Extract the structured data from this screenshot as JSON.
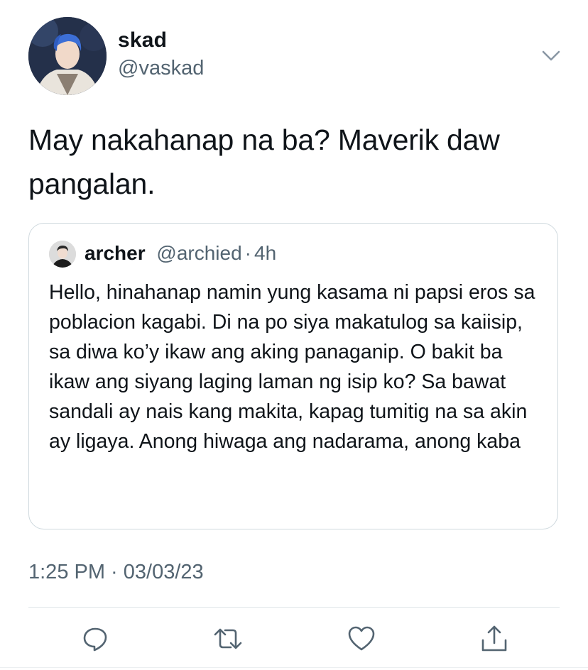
{
  "author": {
    "display_name": "skad",
    "handle": "@vaskad"
  },
  "tweet": {
    "text": "May nakahanap na ba? Maverik daw pangalan.",
    "timestamp": "1:25 PM · 03/03/23"
  },
  "quoted_tweet": {
    "display_name": "archer",
    "handle": "@archied",
    "separator": "·",
    "age": "4h",
    "text": "Hello, hinahanap namin yung kasama ni papsi eros sa poblacion kagabi. Di na po siya makatulog sa kaiisip, sa diwa ko’y ikaw ang aking panaganip. O bakit ba ikaw ang siyang laging laman ng isip ko? Sa bawat sandali ay nais kang makita, kapag tumitig na sa akin ay ligaya. Anong hiwaga ang nadarama, anong kaba"
  },
  "actions": [
    {
      "icon": "reply-icon"
    },
    {
      "icon": "retweet-icon"
    },
    {
      "icon": "like-icon"
    },
    {
      "icon": "share-icon"
    }
  ],
  "colors": {
    "text_primary": "#0f1419",
    "text_secondary": "#536471",
    "border": "#cfd9de",
    "icon": "#536471"
  }
}
